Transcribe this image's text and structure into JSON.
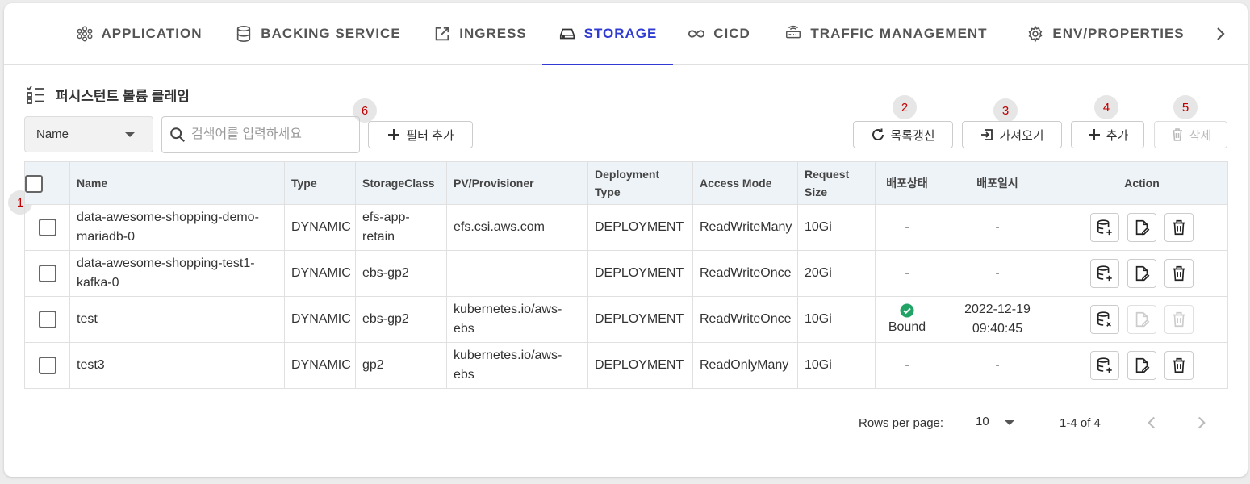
{
  "tabs": [
    {
      "label": "APPLICATION",
      "icon": "hexagon-network-icon",
      "active": false
    },
    {
      "label": "BACKING SERVICE",
      "icon": "database-icon",
      "active": false
    },
    {
      "label": "INGRESS",
      "icon": "external-link-icon",
      "active": false
    },
    {
      "label": "STORAGE",
      "icon": "hard-drive-icon",
      "active": true
    },
    {
      "label": "CICD",
      "icon": "infinity-icon",
      "active": false
    },
    {
      "label": "TRAFFIC MANAGEMENT",
      "icon": "router-icon",
      "active": false
    },
    {
      "label": "ENV/PROPERTIES",
      "icon": "gear-icon",
      "active": false
    }
  ],
  "colors": {
    "accent": "#2f3bd1",
    "marker_text": "#c00000",
    "success": "#21a366"
  },
  "section": {
    "title": "퍼시스턴트 볼륨 클레임"
  },
  "markers": [
    "1",
    "2",
    "3",
    "4",
    "5",
    "6"
  ],
  "toolbar": {
    "search_field": "Name",
    "search_placeholder": "검색어를 입력하세요",
    "add_filter": "필터 추가",
    "refresh": "목록갱신",
    "import": "가져오기",
    "add": "추가",
    "delete": "삭제"
  },
  "table": {
    "headers": {
      "name": "Name",
      "type": "Type",
      "storage_class": "StorageClass",
      "provisioner": "PV/Provisioner",
      "deployment_type": "Deployment Type",
      "access_mode": "Access Mode",
      "request_size": "Request Size",
      "status": "배포상태",
      "deployed_at": "배포일시",
      "action": "Action"
    },
    "rows": [
      {
        "name": "data-awesome-shopping-demo-mariadb-0",
        "type": "DYNAMIC",
        "storage_class": "efs-app-retain",
        "provisioner": "efs.csi.aws.com",
        "deployment_type": "DEPLOYMENT",
        "access_mode": "ReadWriteMany",
        "request_size": "10Gi",
        "status": "-",
        "deployed_at": "-"
      },
      {
        "name": "data-awesome-shopping-test1-kafka-0",
        "type": "DYNAMIC",
        "storage_class": "ebs-gp2",
        "provisioner": "",
        "deployment_type": "DEPLOYMENT",
        "access_mode": "ReadWriteOnce",
        "request_size": "20Gi",
        "status": "-",
        "deployed_at": "-"
      },
      {
        "name": "test",
        "type": "DYNAMIC",
        "storage_class": "ebs-gp2",
        "provisioner": "kubernetes.io/aws-ebs",
        "deployment_type": "DEPLOYMENT",
        "access_mode": "ReadWriteOnce",
        "request_size": "10Gi",
        "status": "Bound",
        "deployed_at": "2022-12-19 09:40:45"
      },
      {
        "name": "test3",
        "type": "DYNAMIC",
        "storage_class": "gp2",
        "provisioner": "kubernetes.io/aws-ebs",
        "deployment_type": "DEPLOYMENT",
        "access_mode": "ReadOnlyMany",
        "request_size": "10Gi",
        "status": "-",
        "deployed_at": "-"
      }
    ]
  },
  "pagination": {
    "rows_per_page_label": "Rows per page:",
    "rows_per_page": "10",
    "range": "1-4 of 4"
  }
}
